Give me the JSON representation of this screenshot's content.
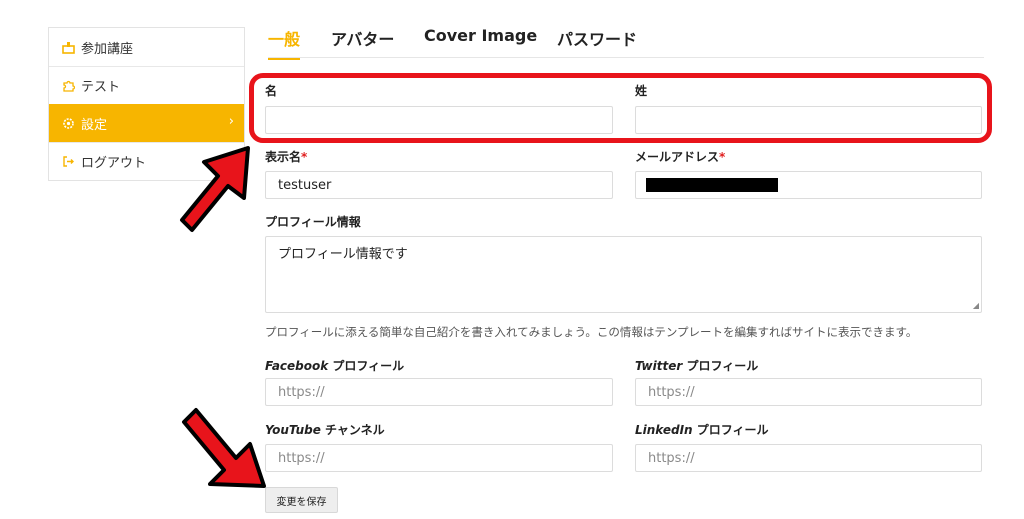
{
  "sidebar": {
    "items": [
      {
        "label": "参加講座",
        "icon": "courses-icon"
      },
      {
        "label": "テスト",
        "icon": "puzzle-icon"
      },
      {
        "label": "設定",
        "icon": "gear-icon",
        "active": true
      },
      {
        "label": "ログアウト",
        "icon": "logout-icon"
      }
    ],
    "active_chevron": "›"
  },
  "tabs": [
    {
      "label": "一般",
      "active": true
    },
    {
      "label": "アバター"
    },
    {
      "label": "Cover Image"
    },
    {
      "label": "パスワード"
    }
  ],
  "form": {
    "first_name": {
      "label": "名",
      "value": ""
    },
    "last_name": {
      "label": "姓",
      "value": ""
    },
    "display_name": {
      "label": "表示名",
      "required_mark": "*",
      "value": "testuser"
    },
    "email": {
      "label": "メールアドレス",
      "required_mark": "*",
      "value_redacted": true
    },
    "profile": {
      "label": "プロフィール情報",
      "value": "プロフィール情報です",
      "help": "プロフィールに添える簡単な自己紹介を書き入れてみましょう。この情報はテンプレートを編集すればサイトに表示できます。"
    },
    "facebook": {
      "label_brand": "Facebook",
      "label_rest": " プロフィール",
      "placeholder": "https://"
    },
    "twitter": {
      "label_brand": "Twitter",
      "label_rest": " プロフィール",
      "placeholder": "https://"
    },
    "youtube": {
      "label_brand": "YouTube",
      "label_rest": " チャンネル",
      "placeholder": "https://"
    },
    "linkedin": {
      "label_brand": "LinkedIn",
      "label_rest": " プロフィール",
      "placeholder": "https://"
    },
    "save_label": "変更を保存"
  },
  "colors": {
    "accent": "#f7b500",
    "highlight": "#e8141b",
    "required": "#e02020"
  }
}
